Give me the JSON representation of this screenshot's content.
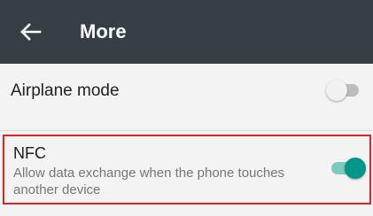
{
  "header": {
    "back_icon": "arrow-left-icon",
    "title": "More"
  },
  "settings": [
    {
      "label": "Airplane mode",
      "summary": "",
      "enabled": false
    },
    {
      "label": "NFC",
      "summary": "Allow data exchange when the phone touches another device",
      "enabled": true
    }
  ],
  "colors": {
    "appbar": "#373f45",
    "accent": "#009688",
    "highlight_border": "#e02424"
  }
}
